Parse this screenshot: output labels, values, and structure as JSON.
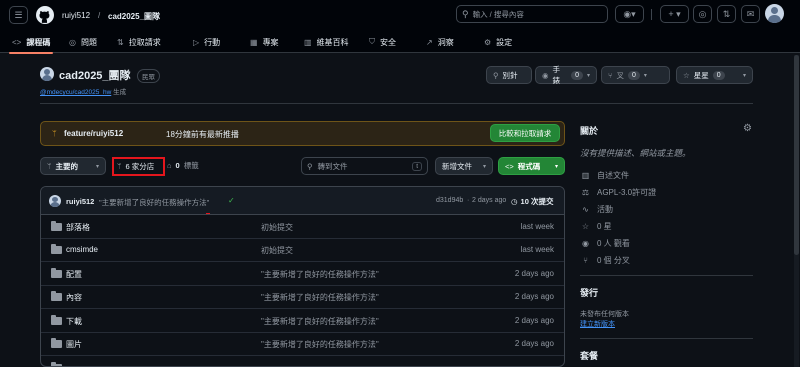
{
  "header": {
    "owner": "ruiyi512",
    "separator": "/",
    "repo": "cad2025_圖隊",
    "search_placeholder": "輸入 / 搜尋內容",
    "search_shortcut": "/"
  },
  "tabs": [
    {
      "label": "課程碼",
      "icon": "code-icon"
    },
    {
      "label": "問題",
      "icon": "issue-icon"
    },
    {
      "label": "拉取請求",
      "icon": "pull-request-icon"
    },
    {
      "label": "行動",
      "icon": "play-icon"
    },
    {
      "label": "專案",
      "icon": "table-icon"
    },
    {
      "label": "維基百科",
      "icon": "book-icon"
    },
    {
      "label": "安全",
      "icon": "shield-icon"
    },
    {
      "label": "洞察",
      "icon": "graph-icon"
    },
    {
      "label": "設定",
      "icon": "gear-icon"
    }
  ],
  "repo": {
    "title": "cad2025_團隊",
    "visibility": "民眾",
    "forked_from": "@mdecycu/cad2025_hw",
    "forked_suffix": "生成",
    "pin_label": "別針",
    "watch_label": "手錶",
    "watch_count": "0",
    "fork_label": "叉",
    "fork_count": "0",
    "star_label": "星星",
    "star_count": "0"
  },
  "banner": {
    "branch": "feature/ruiyi512",
    "text": "18分鐘前有最新推播",
    "button": "比較和拉取請求"
  },
  "branchbar": {
    "branch_button": "主要的",
    "branches": "6 家分店",
    "tags_count": "0",
    "tags_label": "標籤",
    "goto_placeholder": "轉到文件",
    "goto_shortcut": "t",
    "add_file": "新增文件",
    "code_button": "程式碼"
  },
  "latest_commit": {
    "author": "ruiyi512",
    "message": "\"主要新增了良好的任務操作方法\"",
    "hash": "d31d94b",
    "dot": "·",
    "time": "2 days ago",
    "commits": "10 次提交"
  },
  "files": [
    {
      "name": "部落格",
      "message": "初始提交",
      "time": "last week"
    },
    {
      "name": "cmsimde",
      "message": "初始提交",
      "time": "last week"
    },
    {
      "name": "配置",
      "message": "\"主要新增了良好的任務操作方法\"",
      "time": "2 days ago"
    },
    {
      "name": "內容",
      "message": "\"主要新增了良好的任務操作方法\"",
      "time": "2 days ago"
    },
    {
      "name": "下載",
      "message": "\"主要新增了良好的任務操作方法\"",
      "time": "2 days ago"
    },
    {
      "name": "圖片",
      "message": "\"主要新增了良好的任務操作方法\"",
      "time": "2 days ago"
    }
  ],
  "sidebar": {
    "about_title": "關於",
    "about_desc": "沒有提供描述、網站或主題。",
    "readme": "自述文件",
    "license": "AGPL-3.0許可證",
    "activity": "活動",
    "stars": "0 星",
    "watching": "0 人 觀看",
    "forks": "0 個 分叉",
    "releases_title": "發行",
    "releases_none": "未發布任何版本",
    "releases_link": "建立新版本",
    "packages_title": "套餐"
  },
  "colors": {
    "accent_underline": "#f78166",
    "green_button": "#238636",
    "link": "#4493f8",
    "highlight_box": "#e5161d"
  }
}
